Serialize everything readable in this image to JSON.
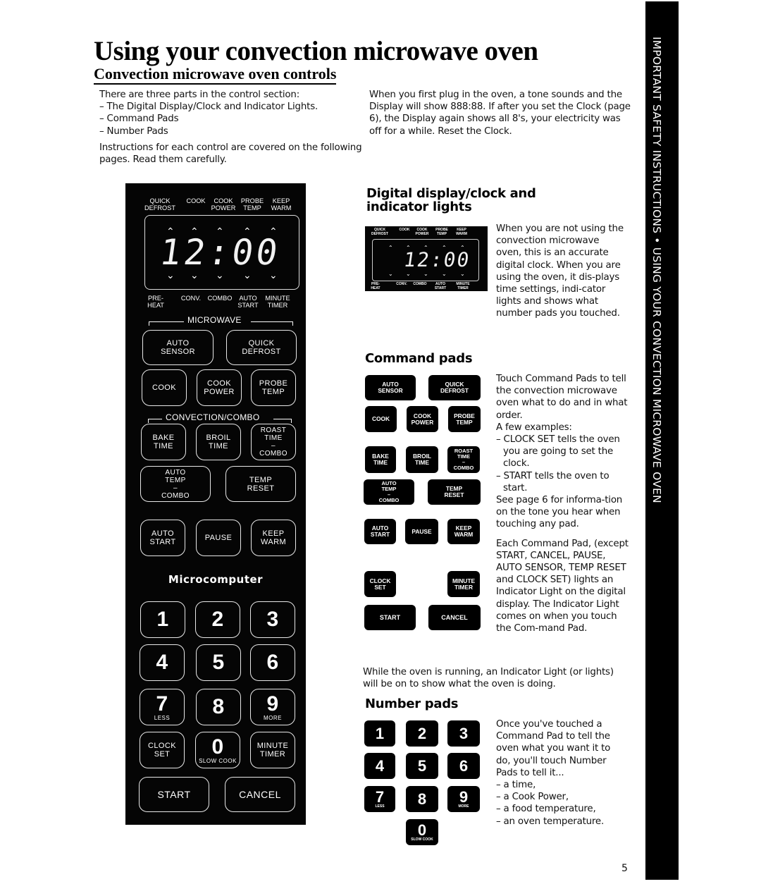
{
  "page": {
    "title": "Using your convection microwave oven",
    "subtitle": "Convection microwave oven controls",
    "page_number": "5",
    "sidebar_text": "IMPORTANT SAFETY INSTRUCTIONS • USING YOUR CONVECTION MICROWAVE OVEN"
  },
  "intro": {
    "left": {
      "lead": "There are three parts in the control section:",
      "items": [
        "– The Digital Display/Clock  and Indicator Lights.",
        "– Command Pads",
        "– Number Pads"
      ],
      "closing": "Instructions for each control are covered on the following pages. Read them carefully."
    },
    "right": "When you first plug in the oven, a tone sounds and the Display will show 888:88. If after you set the Clock (page 6), the Display again shows all 8's, your electricity was off for a while. Reset the Clock."
  },
  "panel": {
    "top_indicators": [
      "QUICK\nDEFROST",
      "COOK",
      "COOK\nPOWER",
      "PROBE\nTEMP",
      "KEEP\nWARM"
    ],
    "display_value": "12:00",
    "bottom_indicators": [
      "PRE-\nHEAT",
      "CONV.",
      "COMBO",
      "AUTO\nSTART",
      "MINUTE\nTIMER"
    ],
    "microwave_label": "MICROWAVE",
    "convection_label": "CONVECTION/COMBO",
    "microcomputer_label": "Microcomputer",
    "pads": {
      "auto_sensor": "AUTO\nSENSOR",
      "quick_defrost": "QUICK\nDEFROST",
      "cook": "COOK",
      "cook_power": "COOK\nPOWER",
      "probe_temp": "PROBE\nTEMP",
      "bake_time": "BAKE\nTIME",
      "broil_time": "BROIL\nTIME",
      "roast_time_combo": "ROAST\nTIME\n–\nCOMBO",
      "auto_temp_combo": "AUTO\nTEMP\n–\nCOMBO",
      "temp_reset": "TEMP\nRESET",
      "auto_start": "AUTO\nSTART",
      "pause": "PAUSE",
      "keep_warm": "KEEP\nWARM",
      "clock_set": "CLOCK\nSET",
      "minute_timer": "MINUTE\nTIMER",
      "start": "START",
      "cancel": "CANCEL"
    },
    "numbers": [
      {
        "digit": "1",
        "sub": ""
      },
      {
        "digit": "2",
        "sub": ""
      },
      {
        "digit": "3",
        "sub": ""
      },
      {
        "digit": "4",
        "sub": ""
      },
      {
        "digit": "5",
        "sub": ""
      },
      {
        "digit": "6",
        "sub": ""
      },
      {
        "digit": "7",
        "sub": "LESS"
      },
      {
        "digit": "8",
        "sub": ""
      },
      {
        "digit": "9",
        "sub": "MORE"
      },
      {
        "digit": "0",
        "sub": "SLOW COOK"
      }
    ]
  },
  "digital_section": {
    "heading_line1": "Digital display/clock and",
    "heading_line2": "indicator lights",
    "text": "When you are not using the convection microwave oven, this is an accurate digital clock. When you are using the oven, it dis-plays time settings, indi-cator lights and shows what number pads you touched."
  },
  "command_section": {
    "heading": "Command pads",
    "text1": "Touch Command Pads to tell the convection microwave oven what to do and in what order.",
    "text_examples": "A few examples:",
    "example1": "– CLOCK SET tells the oven you are going to set the clock.",
    "example2": "– START tells the oven to start.",
    "text2": "See page 6 for informa-tion on the tone you hear when touching any pad.",
    "text3": "Each Command Pad, (except START, CANCEL, PAUSE, AUTO SENSOR, TEMP RESET and CLOCK SET) lights an Indicator Light on the digital display. The Indicator Light comes on when you touch the Com-mand Pad.",
    "text4": "While the oven is running, an Indicator Light (or lights) will be on to show what the oven is doing."
  },
  "number_section": {
    "heading": "Number pads",
    "text": "Once you've touched a Command Pad to tell the oven what you want it to do, you'll touch Number Pads to tell it...",
    "items": [
      "– a time,",
      "– a Cook Power,",
      "– a food temperature,",
      "– an oven temperature."
    ]
  }
}
